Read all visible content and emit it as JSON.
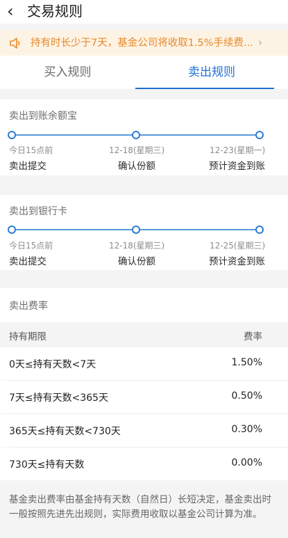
{
  "header": {
    "back_icon": "chevron-left-icon",
    "title": "交易规则"
  },
  "notice": {
    "icon": "speaker-icon",
    "text": "持有时长少于7天，基金公司将收取1.5%手续费...",
    "arrow": "›",
    "color": "#e8892b"
  },
  "tabs": {
    "buy": "买入规则",
    "sell": "卖出规则",
    "active": "sell"
  },
  "sections": [
    {
      "title": "卖出到账余额宝",
      "steps": [
        {
          "date": "今日15点前",
          "label": "卖出提交"
        },
        {
          "date": "12-18(星期三)",
          "label": "确认份额"
        },
        {
          "date": "12-23(星期一)",
          "label": "预计资金到账"
        }
      ]
    },
    {
      "title": "卖出到银行卡",
      "steps": [
        {
          "date": "今日15点前",
          "label": "卖出提交"
        },
        {
          "date": "12-18(星期三)",
          "label": "确认份额"
        },
        {
          "date": "12-25(星期三)",
          "label": "预计资金到账"
        }
      ]
    }
  ],
  "fee": {
    "title": "卖出费率",
    "col_period": "持有期限",
    "col_rate": "费率",
    "rows": [
      {
        "period": "0天≤持有天数<7天",
        "rate": "1.50%"
      },
      {
        "period": "7天≤持有天数<365天",
        "rate": "0.50%"
      },
      {
        "period": "365天≤持有天数<730天",
        "rate": "0.30%"
      },
      {
        "period": "730天≤持有天数",
        "rate": "0.00%"
      }
    ]
  },
  "footnote": "基金卖出费率由基金持有天数（自然日）长短决定，基金卖出时一般按照先进先出规则，实际费用收取以基金公司计算为准。",
  "colors": {
    "accent": "#1f6fd6",
    "notice_bg": "#fdf3e4"
  }
}
